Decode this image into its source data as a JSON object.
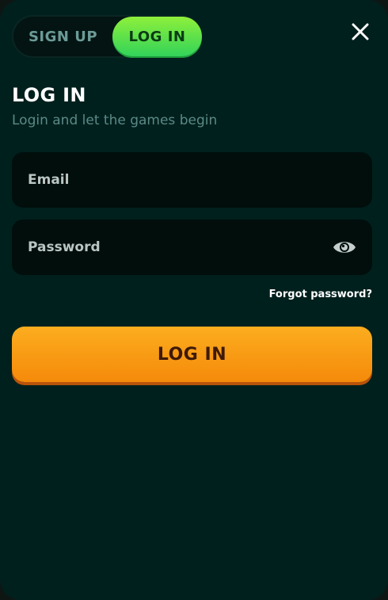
{
  "tabs": {
    "signup_label": "SIGN UP",
    "login_label": "LOG IN"
  },
  "header": {
    "title": "LOG IN",
    "subtitle": "Login and let the games begin"
  },
  "form": {
    "email_placeholder": "Email",
    "password_placeholder": "Password",
    "forgot_label": "Forgot password?",
    "submit_label": "LOG IN"
  },
  "icons": {
    "close": "close-icon",
    "password_toggle": "eye-icon"
  },
  "colors": {
    "background": "#00201d",
    "active_tab": "#32d35a",
    "primary_button": "#f58a0a"
  }
}
